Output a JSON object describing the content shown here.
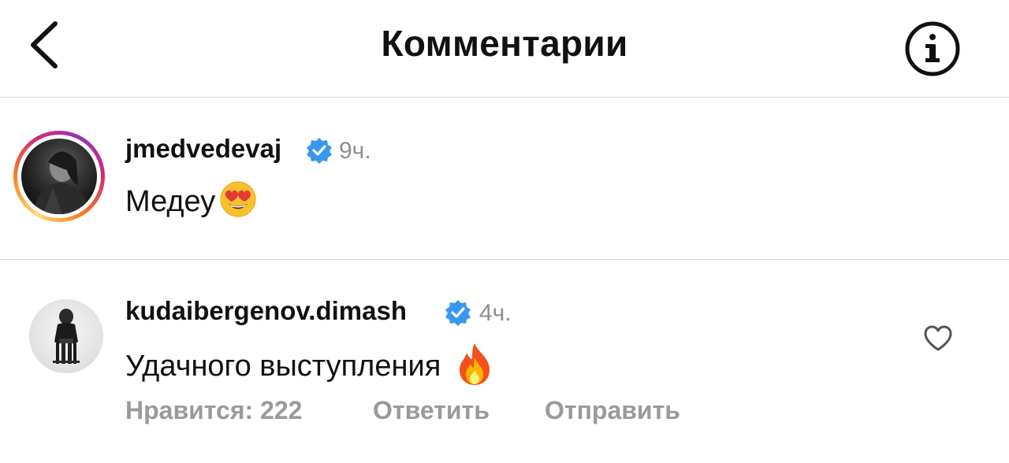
{
  "header": {
    "title": "Комментарии",
    "back_icon": "chevron-left-icon",
    "info_icon": "info-circle-icon"
  },
  "comments": [
    {
      "username": "jmedvedevaj",
      "verified": true,
      "time": "9ч.",
      "text": "Медеу",
      "emoji": "heart-eyes-emoji",
      "story_ring": true
    },
    {
      "username": "kudaibergenov.dimash",
      "verified": true,
      "time": "4ч.",
      "text": "Удачного выступления",
      "emoji": "fire-emoji",
      "likes_label": "Нравится: 222",
      "reply_label": "Ответить",
      "send_label": "Отправить",
      "heart_icon": "heart-outline-icon"
    }
  ],
  "colors": {
    "verified_blue": "#3897f0",
    "secondary_text": "#8e8e8e",
    "divider": "#dcdcdc"
  }
}
